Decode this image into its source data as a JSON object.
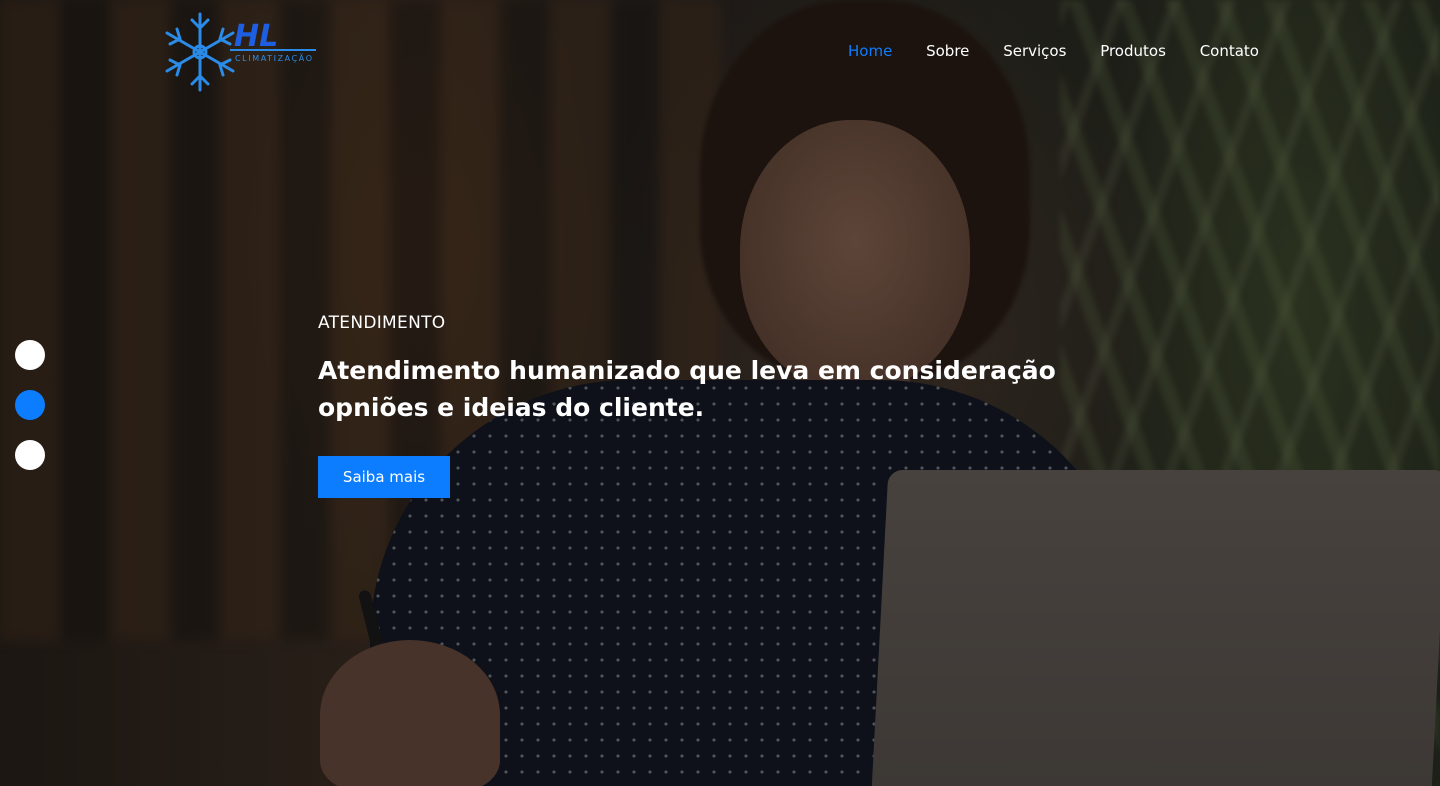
{
  "brand": {
    "logo_letters": "HL",
    "logo_subtitle": "CLIMATIZAÇÃO",
    "icon": "snowflake-icon",
    "accent_color": "#0d7dff"
  },
  "nav": {
    "items": [
      {
        "label": "Home",
        "active": true
      },
      {
        "label": "Sobre",
        "active": false
      },
      {
        "label": "Serviços",
        "active": false
      },
      {
        "label": "Produtos",
        "active": false
      },
      {
        "label": "Contato",
        "active": false
      }
    ]
  },
  "slider": {
    "total_slides": 3,
    "active_index": 2
  },
  "hero": {
    "eyebrow": "ATENDIMENTO",
    "headline_line1": "Atendimento humanizado que leva em consideração",
    "headline_line2": "opniões e ideias do cliente.",
    "cta_label": "Saiba mais"
  }
}
